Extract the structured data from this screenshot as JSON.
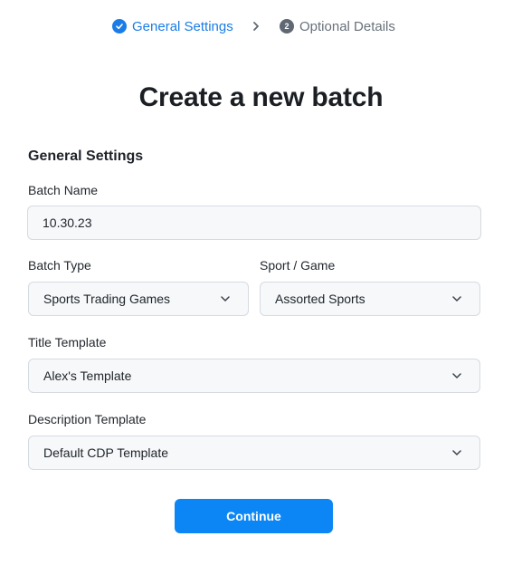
{
  "stepper": {
    "steps": [
      {
        "label": "General Settings",
        "state": "completed",
        "icon": "check-circle-icon"
      },
      {
        "label": "Optional Details",
        "state": "pending",
        "number": "2"
      }
    ],
    "separator_icon": "chevron-right-icon"
  },
  "page_title": "Create a new batch",
  "section_title": "General Settings",
  "fields": {
    "batch_name": {
      "label": "Batch Name",
      "value": "10.30.23"
    },
    "batch_type": {
      "label": "Batch Type",
      "value": "Sports Trading Games"
    },
    "sport_game": {
      "label": "Sport / Game",
      "value": "Assorted Sports"
    },
    "title_template": {
      "label": "Title Template",
      "value": "Alex's Template"
    },
    "description_template": {
      "label": "Description Template",
      "value": "Default CDP Template"
    }
  },
  "continue_label": "Continue",
  "colors": {
    "accent": "#1a7ce6",
    "button": "#0b86f4",
    "field_bg": "#f6f8fa",
    "field_border": "#d6dbe1"
  }
}
